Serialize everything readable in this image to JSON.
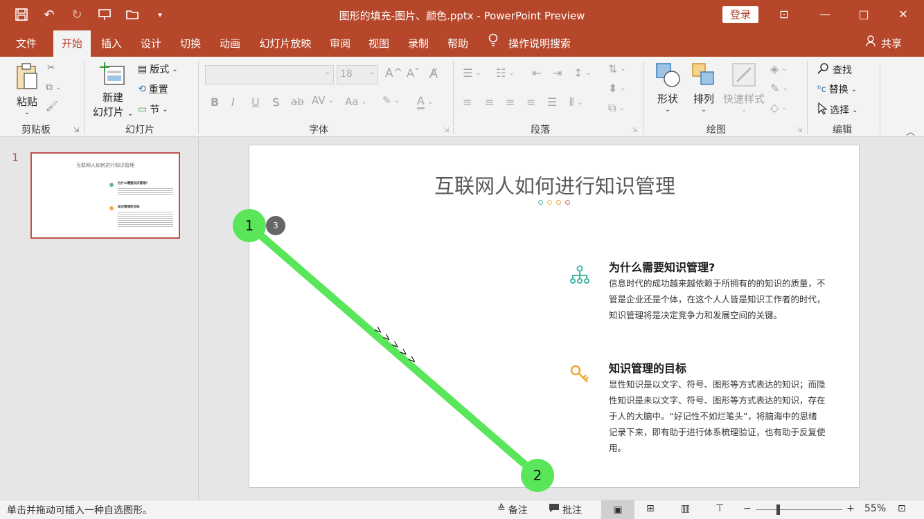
{
  "window": {
    "title": "图形的填充-图片、颜色.pptx  -  PowerPoint Preview",
    "login_label": "登录",
    "minimize_icon": "—",
    "restore_icon": "□",
    "close_icon": "✕",
    "ribbon_display_icon": "⊡"
  },
  "tabs": [
    "文件",
    "开始",
    "插入",
    "设计",
    "切换",
    "动画",
    "幻灯片放映",
    "审阅",
    "视图",
    "录制",
    "帮助"
  ],
  "search_tab": "操作说明搜索",
  "share_label": "共享",
  "ribbon": {
    "clipboard": {
      "paste": "粘贴",
      "group": "剪贴板"
    },
    "slides": {
      "new_slide_1": "新建",
      "new_slide_2": "幻灯片",
      "layout": "版式",
      "reset": "重置",
      "section": "节",
      "group": "幻灯片"
    },
    "font": {
      "size": "18",
      "group": "字体",
      "bold": "B",
      "italic": "I",
      "underline": "U",
      "shadow": "S",
      "strike": "ab",
      "spacing": "AV",
      "case": "Aa",
      "color": "A",
      "grow": "A^",
      "shrink": "Aˇ"
    },
    "paragraph": {
      "group": "段落"
    },
    "drawing": {
      "shapes": "形状",
      "arrange": "排列",
      "quick_styles": "快速样式",
      "group": "绘图"
    },
    "editing": {
      "find": "查找",
      "replace": "替换",
      "select": "选择",
      "group": "编辑"
    }
  },
  "thumbnail": {
    "number": "1",
    "title": "互联网人如何进行知识管理",
    "h1": "为什么需要知识管理?",
    "h2": "知识管理的目标"
  },
  "slide": {
    "title": "互联网人如何进行知识管理",
    "section1_heading": "为什么需要知识管理?",
    "section1_lines": [
      "信息时代的成功越来越依赖于所拥有的的知识的质量，不",
      "管是企业还是个体，在这个人人皆是知识工作者的时代，",
      "知识管理将是决定竞争力和发展空间的关键。"
    ],
    "section2_heading": "知识管理的目标",
    "section2_lines": [
      "显性知识是以文字、符号、图形等方式表达的知识；而隐",
      "性知识是未以文字、符号、图形等方式表达的知识，存在",
      "于人的大脑中。“好记性不如烂笔头”，将脑海中的思绪",
      "记录下来，即有助于进行体系梳理验证，也有助于反复使",
      "用。"
    ],
    "dot_colors": [
      "#5ab4ac",
      "#f0c040",
      "#e8a040",
      "#d06060"
    ]
  },
  "overlay": {
    "start_label": "1",
    "end_label": "2",
    "step_badge": "3",
    "arrows": "> > > > >",
    "color": "#5ae65a"
  },
  "status": {
    "hint": "单击并拖动可插入一种自选图形。",
    "notes": "备注",
    "comments": "批注",
    "zoom": "55%"
  },
  "colors": {
    "accent": "#b7472a"
  }
}
